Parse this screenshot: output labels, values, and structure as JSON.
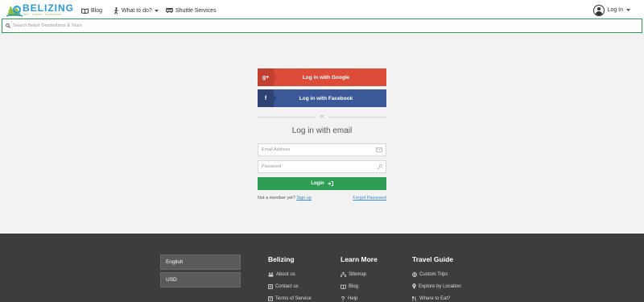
{
  "brand": {
    "name": "BELIZING",
    "tagline": "feel · inspire · experience",
    "colors": {
      "blue": "#2a9ad6",
      "green": "#8cbf3f",
      "accent": "#2e9e56"
    }
  },
  "nav": {
    "blog": "Blog",
    "what_to_do": "What to do?",
    "shuttle": "Shuttle Services",
    "login": "Log In"
  },
  "search": {
    "placeholder": "Search Belize Destinations & Tours"
  },
  "login": {
    "google_label": "Log in with Google",
    "google_icon": "g+",
    "facebook_label": "Log in with Facebook",
    "facebook_icon": "f",
    "or_text": "or",
    "email_title": "Log in with email",
    "email_placeholder": "Email Address",
    "password_placeholder": "Password",
    "submit_label": "Login",
    "not_member_text": "Not a member yet?",
    "signup_link": "Sign up",
    "forgot_link": "Forgot Password",
    "colors": {
      "google": "#dd4b39",
      "facebook": "#3b5998",
      "login": "#2e9e56"
    }
  },
  "footer": {
    "language": "English",
    "currency": "USD",
    "columns": [
      {
        "title": "Belizing",
        "links": [
          {
            "label": "About us",
            "icon": "about-icon"
          },
          {
            "label": "Contact us",
            "icon": "contact-icon"
          },
          {
            "label": "Terms of Service",
            "icon": "terms-icon"
          }
        ]
      },
      {
        "title": "Learn More",
        "links": [
          {
            "label": "Sitemap",
            "icon": "sitemap-icon"
          },
          {
            "label": "Blog",
            "icon": "blog-icon"
          },
          {
            "label": "Help",
            "icon": "help-icon"
          }
        ]
      },
      {
        "title": "Travel Guide",
        "links": [
          {
            "label": "Custom Trips",
            "icon": "trips-icon"
          },
          {
            "label": "Explore by Location",
            "icon": "location-icon"
          },
          {
            "label": "Where to Eat?",
            "icon": "eat-icon"
          }
        ]
      }
    ]
  }
}
